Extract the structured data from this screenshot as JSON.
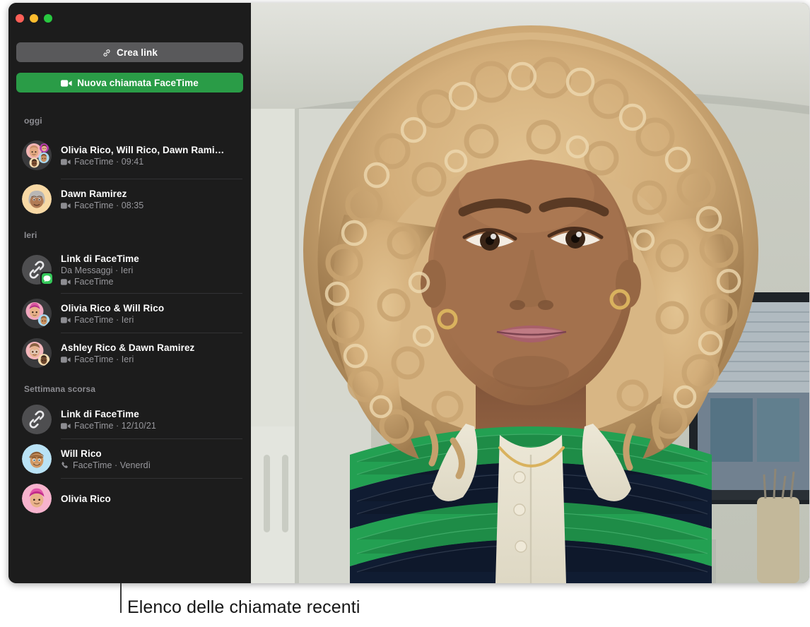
{
  "window": {
    "traffic_lights": {
      "close_color": "#ff5f57",
      "minimize_color": "#febc2e",
      "maximize_color": "#28c840"
    }
  },
  "sidebar": {
    "actions": {
      "create_link": {
        "label": "Crea link",
        "icon": "link-icon",
        "bg_color": "#59595b"
      },
      "new_call": {
        "label": "Nuova chiamata FaceTime",
        "icon": "video-camera-icon",
        "bg_color": "#2a9c47"
      }
    },
    "sections": [
      {
        "header": "oggi",
        "rows": [
          {
            "title": "Olivia Rico, Will Rico, Dawn Rami…",
            "subtitle": "FaceTime · 09:41",
            "sub_icon": "video-camera-icon",
            "avatar": "group-4",
            "divider": true
          },
          {
            "title": "Dawn Ramirez",
            "subtitle": "FaceTime · 08:35",
            "sub_icon": "video-camera-icon",
            "avatar": "dawn",
            "divider": false
          }
        ]
      },
      {
        "header": "Ieri",
        "rows": [
          {
            "title": "Link di FaceTime",
            "source": "Da Messaggi · Ieri",
            "subtitle": "FaceTime",
            "sub_icon": "video-camera-icon",
            "avatar": "link-messages",
            "divider": true
          },
          {
            "title": "Olivia Rico & Will Rico",
            "subtitle": "FaceTime · Ieri",
            "sub_icon": "video-camera-icon",
            "avatar": "olivia-will",
            "divider": true
          },
          {
            "title": "Ashley Rico & Dawn Ramirez",
            "subtitle": "FaceTime · Ieri",
            "sub_icon": "video-camera-icon",
            "avatar": "ashley-dawn",
            "divider": false
          }
        ]
      },
      {
        "header": "Settimana scorsa",
        "rows": [
          {
            "title": "Link di FaceTime",
            "subtitle": "FaceTime · 12/10/21",
            "sub_icon": "video-camera-icon",
            "avatar": "link",
            "divider": true
          },
          {
            "title": "Will Rico",
            "subtitle": "FaceTime · Venerdì",
            "sub_icon": "phone-icon",
            "avatar": "will",
            "divider": true
          },
          {
            "title": "Olivia Rico",
            "subtitle": "",
            "sub_icon": "",
            "avatar": "olivia",
            "divider": false
          }
        ]
      }
    ]
  },
  "video_pane": {
    "description": "Anteprima video di una persona",
    "alt": "Videochiamata FaceTime in corso"
  },
  "annotation": {
    "caption": "Elenco delle chiamate recenti"
  }
}
